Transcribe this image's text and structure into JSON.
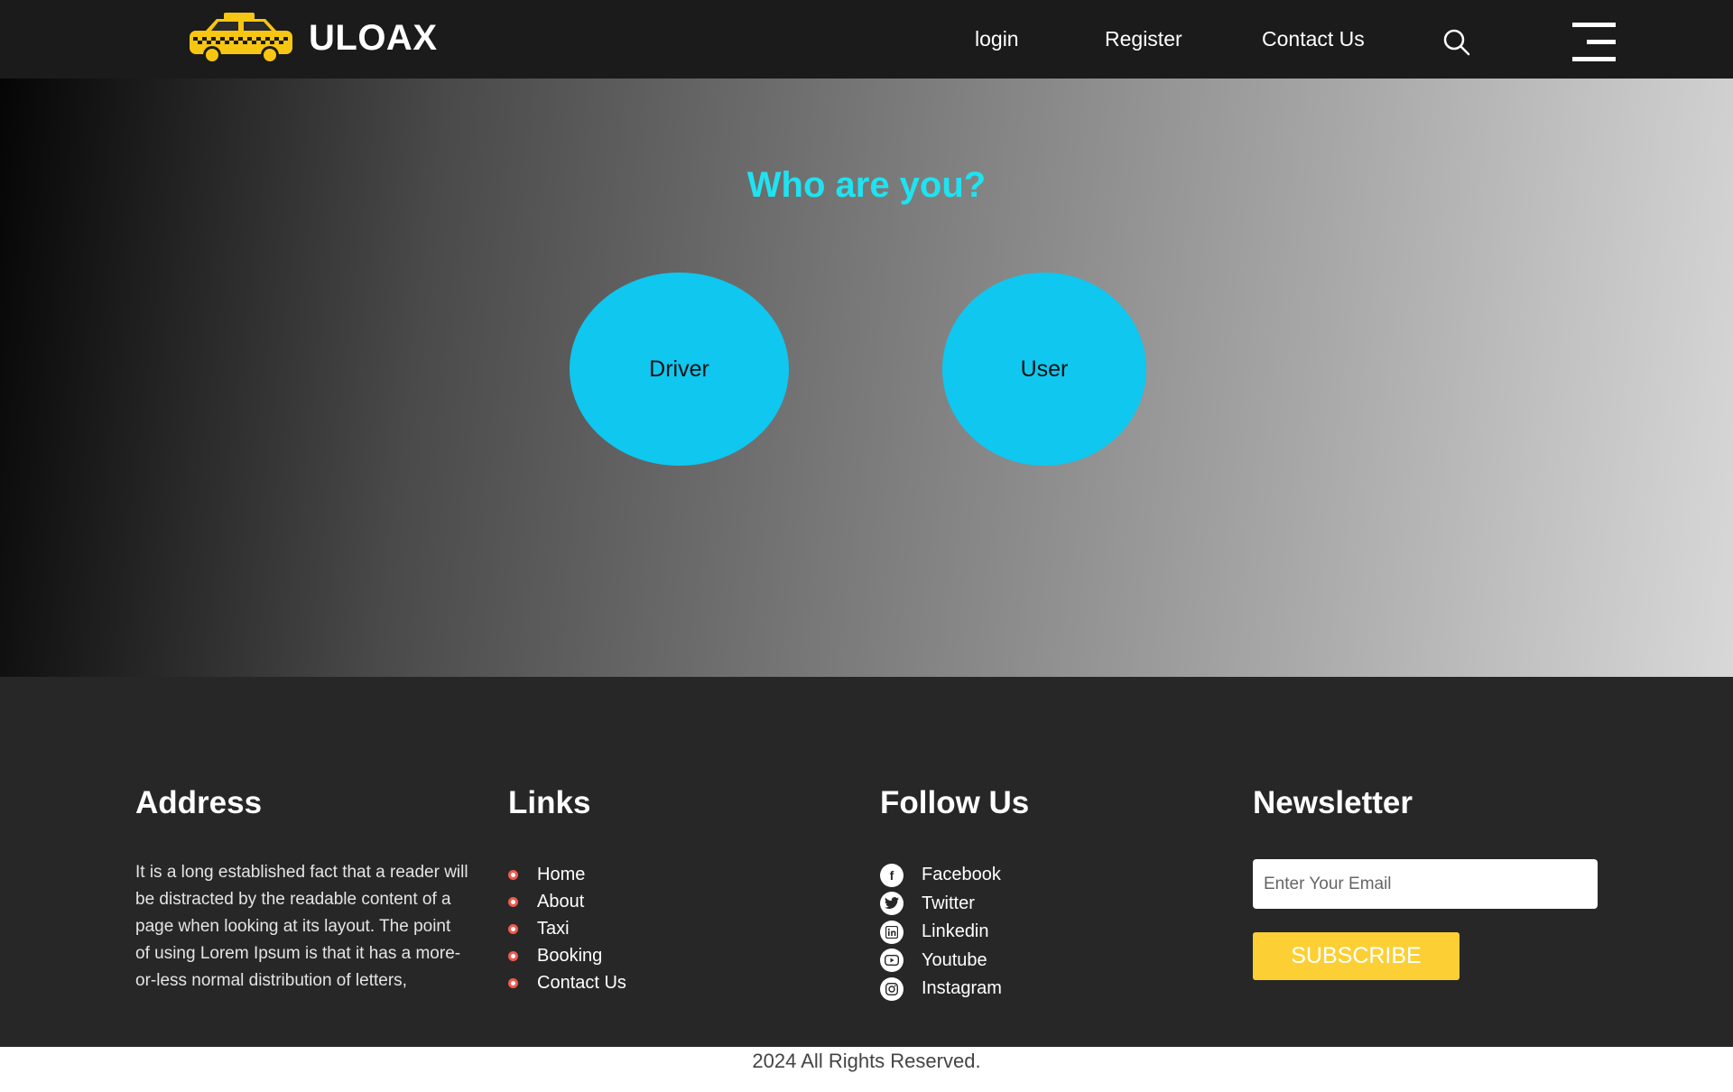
{
  "header": {
    "brand": "ULOAX",
    "nav": {
      "login": "login",
      "register": "Register",
      "contact": "Contact Us"
    }
  },
  "hero": {
    "title": "Who are you?",
    "roles": {
      "driver": "Driver",
      "user": "User"
    }
  },
  "footer": {
    "address": {
      "title": "Address",
      "text": "It is a long established fact that a reader will be distracted by the readable content of a page when looking at its layout. The point of using Lorem Ipsum is that it has a more-or-less normal distribution of letters,"
    },
    "links": {
      "title": "Links",
      "items": [
        "Home",
        "About",
        "Taxi",
        "Booking",
        "Contact Us"
      ]
    },
    "follow": {
      "title": "Follow Us",
      "items": [
        {
          "label": "Facebook",
          "icon": "facebook-icon"
        },
        {
          "label": "Twitter",
          "icon": "twitter-icon"
        },
        {
          "label": "Linkedin",
          "icon": "linkedin-icon"
        },
        {
          "label": "Youtube",
          "icon": "youtube-icon"
        },
        {
          "label": "Instagram",
          "icon": "instagram-icon"
        }
      ]
    },
    "newsletter": {
      "title": "Newsletter",
      "placeholder": "Enter Your Email",
      "button": "Subscribe"
    }
  },
  "copyright": "2024 All Rights Reserved.",
  "colors": {
    "header_bg": "#1b1b1b",
    "accent_cyan": "#1ee3f1",
    "role_circle": "#0fc7ef",
    "footer_bg": "#272727",
    "subscribe": "#fcd034",
    "taxi_yellow": "#f7c612"
  }
}
